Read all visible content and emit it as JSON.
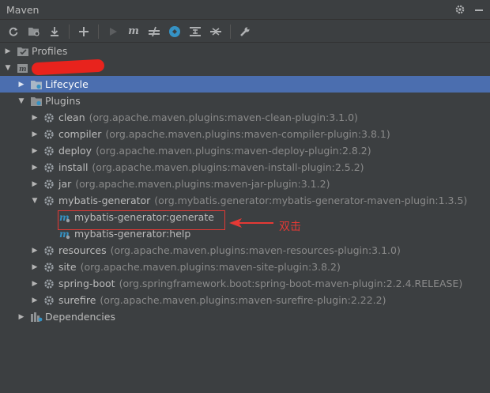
{
  "window": {
    "title": "Maven"
  },
  "toolbar": {
    "buttons": [
      "refresh",
      "reimport",
      "download",
      "add",
      "run",
      "execute-goal",
      "skip-tests",
      "offline",
      "collapse",
      "expand",
      "settings"
    ]
  },
  "tree": {
    "profiles": "Profiles",
    "project_name": "",
    "lifecycle": "Lifecycle",
    "plugins": "Plugins",
    "plugin_items": [
      {
        "name": "clean",
        "coord": "(org.apache.maven.plugins:maven-clean-plugin:3.1.0)"
      },
      {
        "name": "compiler",
        "coord": "(org.apache.maven.plugins:maven-compiler-plugin:3.8.1)"
      },
      {
        "name": "deploy",
        "coord": "(org.apache.maven.plugins:maven-deploy-plugin:2.8.2)"
      },
      {
        "name": "install",
        "coord": "(org.apache.maven.plugins:maven-install-plugin:2.5.2)"
      },
      {
        "name": "jar",
        "coord": "(org.apache.maven.plugins:maven-jar-plugin:3.1.2)"
      },
      {
        "name": "mybatis-generator",
        "coord": "(org.mybatis.generator:mybatis-generator-maven-plugin:1.3.5)"
      },
      {
        "name": "resources",
        "coord": "(org.apache.maven.plugins:maven-resources-plugin:3.1.0)"
      },
      {
        "name": "site",
        "coord": "(org.apache.maven.plugins:maven-site-plugin:3.8.2)"
      },
      {
        "name": "spring-boot",
        "coord": "(org.springframework.boot:spring-boot-maven-plugin:2.2.4.RELEASE)"
      },
      {
        "name": "surefire",
        "coord": "(org.apache.maven.plugins:maven-surefire-plugin:2.22.2)"
      }
    ],
    "goals": [
      "mybatis-generator:generate",
      "mybatis-generator:help"
    ],
    "dependencies": "Dependencies"
  },
  "annotation": {
    "text": "双击"
  },
  "colors": {
    "background": "#3c3f41",
    "selection": "#4b6eaf",
    "annotation": "#e53935"
  }
}
